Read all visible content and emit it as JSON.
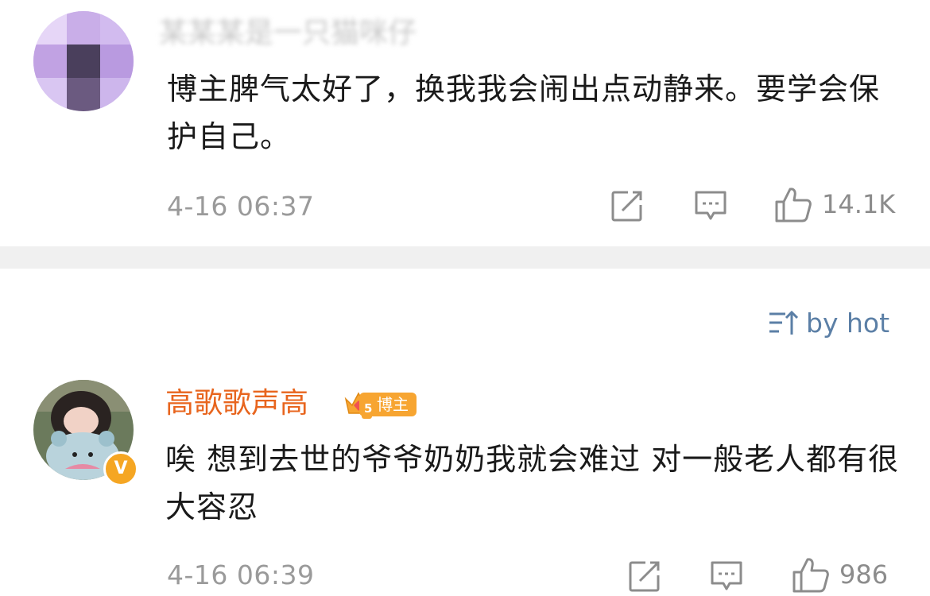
{
  "comments": [
    {
      "username": "某某某是一只猫咪仔",
      "text": "博主脾气太好了，换我我会闹出点动静来。要学会保护自己。",
      "time": "4-16 06:37",
      "like_count": "14.1K",
      "username_blurred": true
    },
    {
      "username": "高歌歌声高",
      "badge_level": "5",
      "badge_label": "博主",
      "verified_mark": "V",
      "text": "唉 想到去世的爷爷奶奶我就会难过 对一般老人都有很大容忍",
      "time": "4-16 06:39",
      "like_count": "986"
    }
  ],
  "sort": {
    "label": "by hot"
  },
  "colors": {
    "username_highlight": "#e8651e",
    "link_blue": "#5b7fa6",
    "badge_orange": "#f7a531",
    "divider": "#f0f0f0"
  },
  "icons": [
    "share-icon",
    "comment-icon",
    "like-icon",
    "sort-icon"
  ]
}
